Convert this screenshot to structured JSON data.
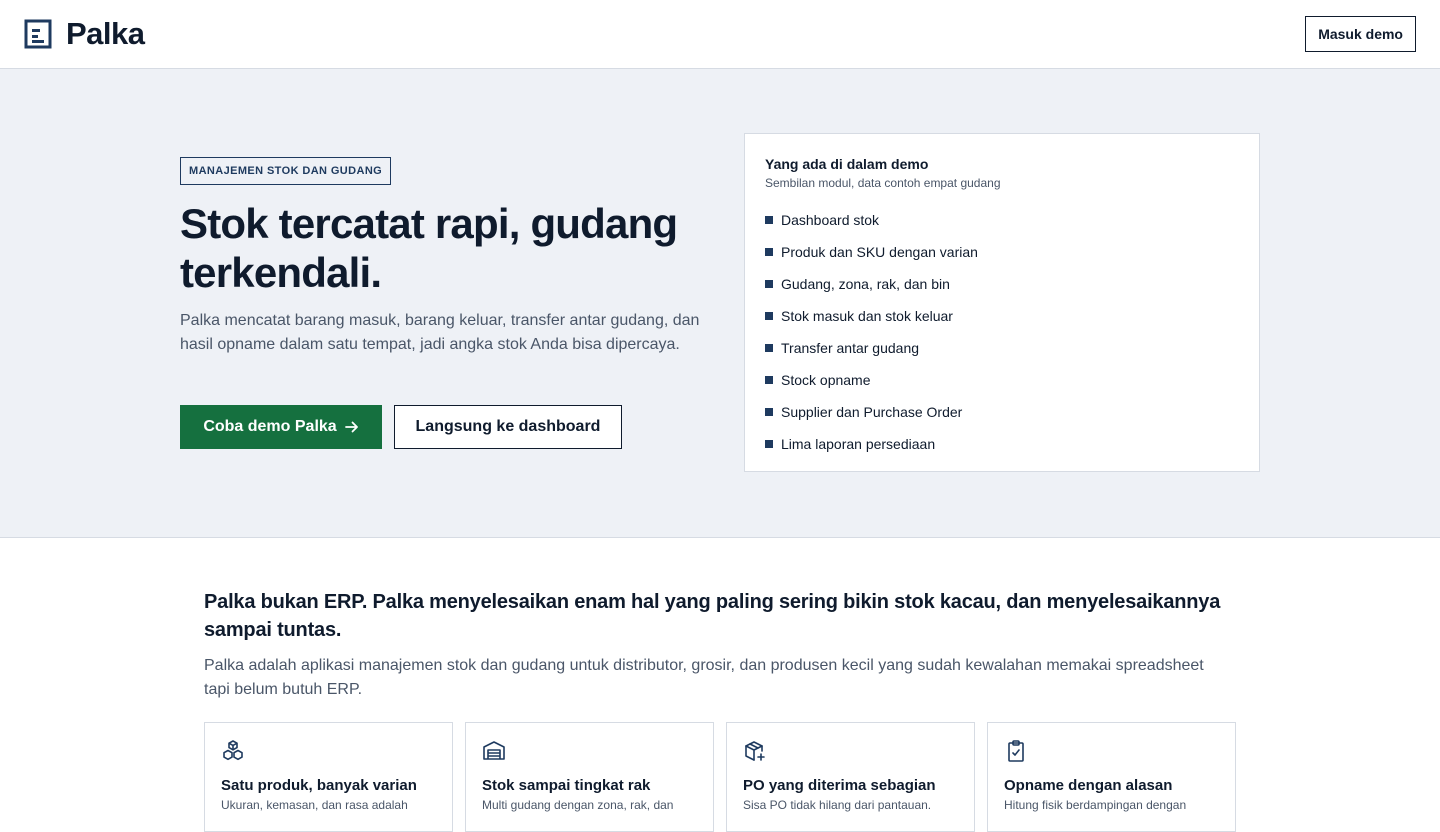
{
  "header": {
    "brand": "Palka",
    "login_label": "Masuk demo"
  },
  "hero": {
    "badge": "MANAJEMEN STOK DAN GUDANG",
    "title": "Stok tercatat rapi, gudang terkendali.",
    "description": "Palka mencatat barang masuk, barang keluar, transfer antar gudang, dan hasil opname dalam satu tempat, jadi angka stok Anda bisa dipercaya.",
    "primary_cta": "Coba demo Palka",
    "secondary_cta": "Langsung ke dashboard"
  },
  "demo_card": {
    "title": "Yang ada di dalam demo",
    "subtitle": "Sembilan modul, data contoh empat gudang",
    "items": [
      "Dashboard stok",
      "Produk dan SKU dengan varian",
      "Gudang, zona, rak, dan bin",
      "Stok masuk dan stok keluar",
      "Transfer antar gudang",
      "Stock opname",
      "Supplier dan Purchase Order",
      "Lima laporan persediaan"
    ]
  },
  "about": {
    "title": "Palka bukan ERP. Palka menyelesaikan enam hal yang paling sering bikin stok kacau, dan menyelesaikannya sampai tuntas.",
    "description": "Palka adalah aplikasi manajemen stok dan gudang untuk distributor, grosir, dan produsen kecil yang sudah kewalahan memakai spreadsheet tapi belum butuh ERP."
  },
  "features": [
    {
      "icon": "boxes-icon",
      "title": "Satu produk, banyak varian",
      "desc": "Ukuran, kemasan, dan rasa adalah"
    },
    {
      "icon": "warehouse-icon",
      "title": "Stok sampai tingkat rak",
      "desc": "Multi gudang dengan zona, rak, dan"
    },
    {
      "icon": "package-plus-icon",
      "title": "PO yang diterima sebagian",
      "desc": "Sisa PO tidak hilang dari pantauan."
    },
    {
      "icon": "clipboard-check-icon",
      "title": "Opname dengan alasan",
      "desc": "Hitung fisik berdampingan dengan"
    }
  ],
  "colors": {
    "primary": "#15703f",
    "navy": "#1e3a5f",
    "hero_bg": "#eef1f6"
  }
}
